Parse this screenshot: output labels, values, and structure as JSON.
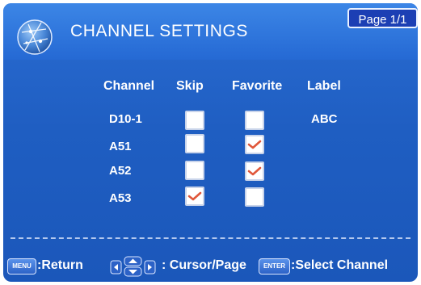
{
  "header": {
    "title": "CHANNEL SETTINGS",
    "page": "Page 1/1"
  },
  "table": {
    "columns": [
      "Channel",
      "Skip",
      "Favorite",
      "Label"
    ],
    "rows": [
      {
        "channel": "D10-1",
        "skip": false,
        "favorite": false,
        "label": "ABC"
      },
      {
        "channel": "A51",
        "skip": false,
        "favorite": true,
        "label": ""
      },
      {
        "channel": "A52",
        "skip": false,
        "favorite": true,
        "label": ""
      },
      {
        "channel": "A53",
        "skip": true,
        "favorite": false,
        "label": ""
      }
    ]
  },
  "footer": {
    "menu_key": "MENU",
    "return_text": ":Return",
    "cursor_text": ": Cursor/Page",
    "enter_key": "ENTER",
    "select_text": ":Select Channel"
  },
  "colors": {
    "background": "#1f5ec2",
    "header": "#3c86e6",
    "check": "#e0573a",
    "text": "#ffffff"
  }
}
